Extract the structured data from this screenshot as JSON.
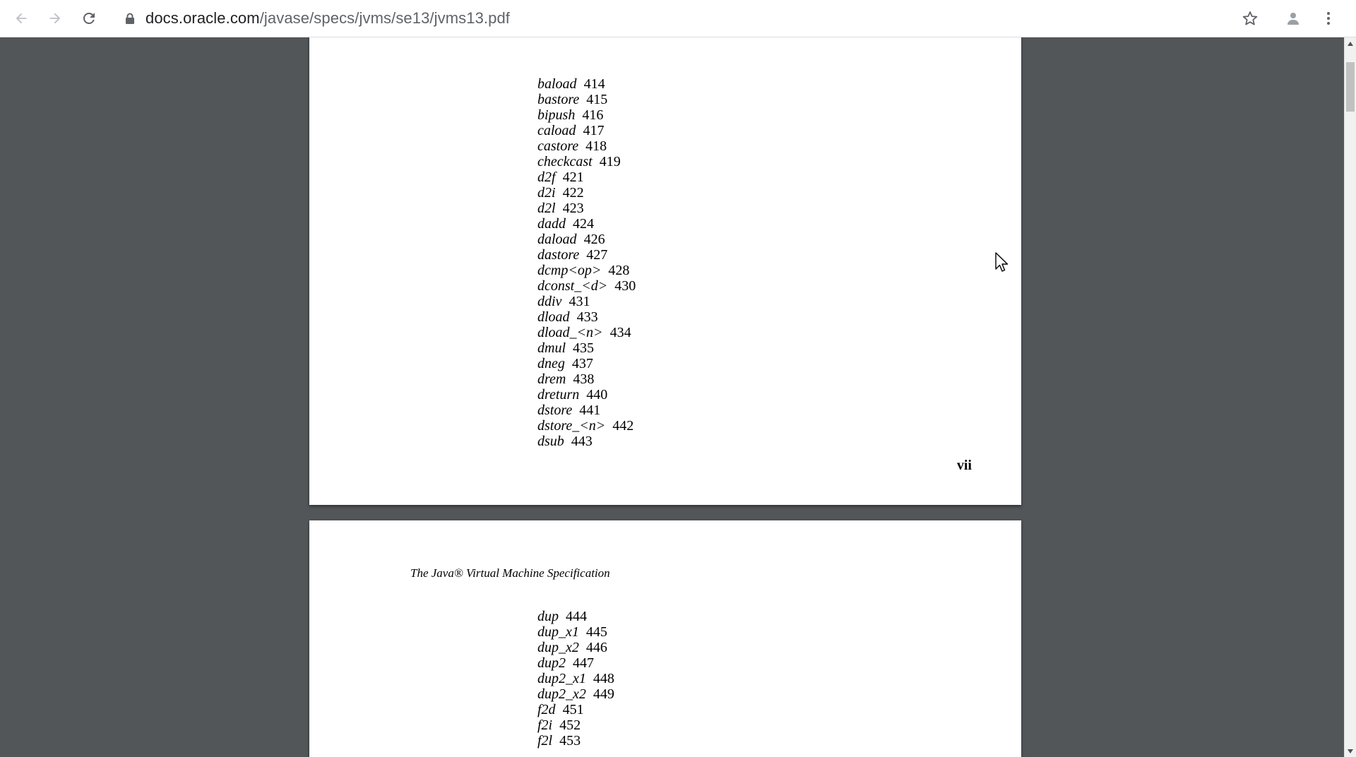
{
  "browser": {
    "address": {
      "host": "docs.oracle.com",
      "path": "/javase/specs/jvms/se13/jvms13.pdf"
    },
    "icons": {
      "back": "arrow-left-icon",
      "forward": "arrow-right-icon",
      "reload": "reload-icon",
      "lock": "lock-icon",
      "bookmark": "star-icon",
      "profile": "profile-icon",
      "menu": "kebab-menu-icon"
    }
  },
  "document": {
    "page1": {
      "entries": [
        {
          "name": "baload",
          "page": "414"
        },
        {
          "name": "bastore",
          "page": "415"
        },
        {
          "name": "bipush",
          "page": "416"
        },
        {
          "name": "caload",
          "page": "417"
        },
        {
          "name": "castore",
          "page": "418"
        },
        {
          "name": "checkcast",
          "page": "419"
        },
        {
          "name": "d2f",
          "page": "421"
        },
        {
          "name": "d2i",
          "page": "422"
        },
        {
          "name": "d2l",
          "page": "423"
        },
        {
          "name": "dadd",
          "page": "424"
        },
        {
          "name": "daload",
          "page": "426"
        },
        {
          "name": "dastore",
          "page": "427"
        },
        {
          "name": "dcmp<op>",
          "page": "428"
        },
        {
          "name": "dconst_<d>",
          "page": "430"
        },
        {
          "name": "ddiv",
          "page": "431"
        },
        {
          "name": "dload",
          "page": "433"
        },
        {
          "name": "dload_<n>",
          "page": "434"
        },
        {
          "name": "dmul",
          "page": "435"
        },
        {
          "name": "dneg",
          "page": "437"
        },
        {
          "name": "drem",
          "page": "438"
        },
        {
          "name": "dreturn",
          "page": "440"
        },
        {
          "name": "dstore",
          "page": "441"
        },
        {
          "name": "dstore_<n>",
          "page": "442"
        },
        {
          "name": "dsub",
          "page": "443"
        }
      ],
      "page_number": "vii"
    },
    "page2": {
      "running_header": "The Java® Virtual Machine Specification",
      "entries": [
        {
          "name": "dup",
          "page": "444"
        },
        {
          "name": "dup_x1",
          "page": "445"
        },
        {
          "name": "dup_x2",
          "page": "446"
        },
        {
          "name": "dup2",
          "page": "447"
        },
        {
          "name": "dup2_x1",
          "page": "448"
        },
        {
          "name": "dup2_x2",
          "page": "449"
        },
        {
          "name": "f2d",
          "page": "451"
        },
        {
          "name": "f2i",
          "page": "452"
        },
        {
          "name": "f2l",
          "page": "453"
        }
      ]
    }
  },
  "colors": {
    "viewer_background": "#525659",
    "toolbar_background": "#ffffff",
    "page_background": "#ffffff"
  }
}
